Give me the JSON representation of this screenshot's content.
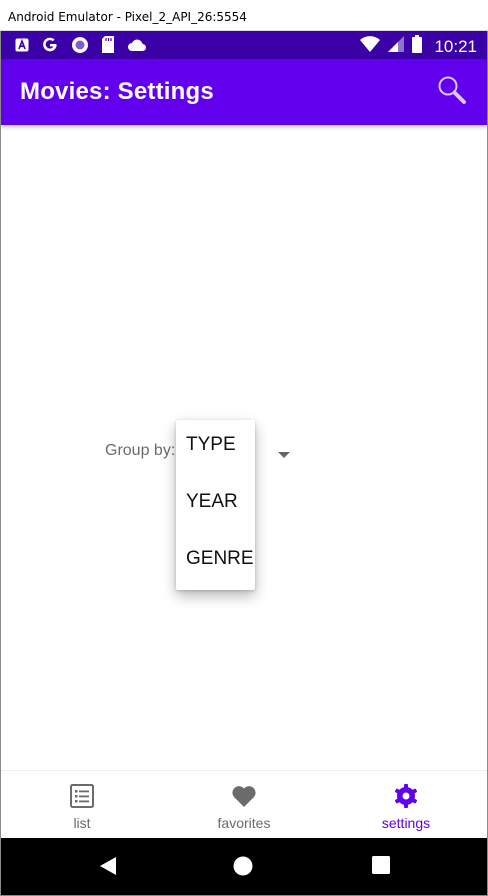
{
  "window": {
    "title": "Android Emulator - Pixel_2_API_26:5554"
  },
  "status_bar": {
    "time": "10:21",
    "left_icons": [
      "a-notification-icon",
      "google-icon",
      "circle-app-icon",
      "sd-card-icon",
      "cloud-icon"
    ],
    "right_icons": [
      "wifi-icon",
      "cell-signal-icon",
      "battery-icon"
    ]
  },
  "app_bar": {
    "title": "Movies: Settings",
    "search_icon": "search-icon"
  },
  "settings": {
    "group_label": "Group by:",
    "options": [
      "TYPE",
      "YEAR",
      "GENRE"
    ]
  },
  "bottom_nav": {
    "items": [
      {
        "label": "list",
        "icon": "list-icon",
        "active": false
      },
      {
        "label": "favorites",
        "icon": "heart-icon",
        "active": false
      },
      {
        "label": "settings",
        "icon": "gear-icon",
        "active": true
      }
    ]
  },
  "colors": {
    "status_bar": "#3b00a6",
    "primary": "#6200ee",
    "inactive": "#6b6b6b"
  }
}
